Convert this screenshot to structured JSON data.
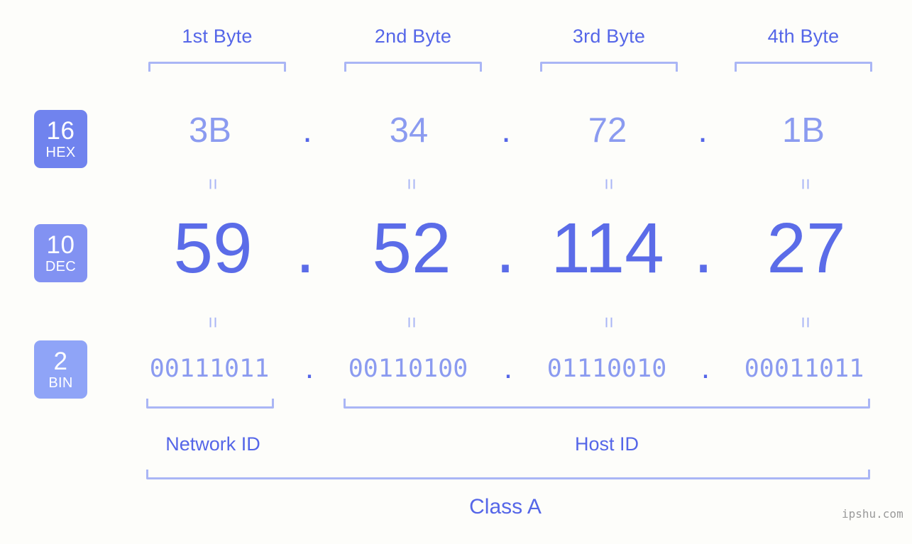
{
  "page": {
    "background_color": "#fdfdfa",
    "watermark": "ipshu.com"
  },
  "colors": {
    "header_text": "#5566e8",
    "bracket": "#aab6f5",
    "hex_value": "#8b9bf0",
    "dec_value": "#5b6ce8",
    "bin_value": "#8b9bf0",
    "dot": "#5566e8",
    "eq_mark": "#aab6f5",
    "badge_hex": "#7083ee",
    "badge_dec": "#8292f2",
    "badge_bin": "#8fa4f7",
    "badge_text": "#ffffff"
  },
  "headers": {
    "bytes": [
      {
        "label": "1st Byte"
      },
      {
        "label": "2nd Byte"
      },
      {
        "label": "3rd Byte"
      },
      {
        "label": "4th Byte"
      }
    ]
  },
  "badges": [
    {
      "number": "16",
      "name": "HEX"
    },
    {
      "number": "10",
      "name": "DEC"
    },
    {
      "number": "2",
      "name": "BIN"
    }
  ],
  "rows": {
    "hex": {
      "base": "16",
      "name": "HEX",
      "values": [
        "3B",
        "34",
        "72",
        "1B"
      ],
      "separator": "."
    },
    "dec": {
      "base": "10",
      "name": "DEC",
      "values": [
        "59",
        "52",
        "114",
        "27"
      ],
      "separator": "."
    },
    "bin": {
      "base": "2",
      "name": "BIN",
      "values": [
        "00111011",
        "00110100",
        "01110010",
        "00011011"
      ],
      "separator": "."
    }
  },
  "equality_marks": {
    "glyph": "=",
    "count_per_row": 4,
    "rows": 2
  },
  "sections": {
    "network_id": {
      "label": "Network ID"
    },
    "host_id": {
      "label": "Host ID"
    },
    "class": {
      "label": "Class A"
    }
  }
}
